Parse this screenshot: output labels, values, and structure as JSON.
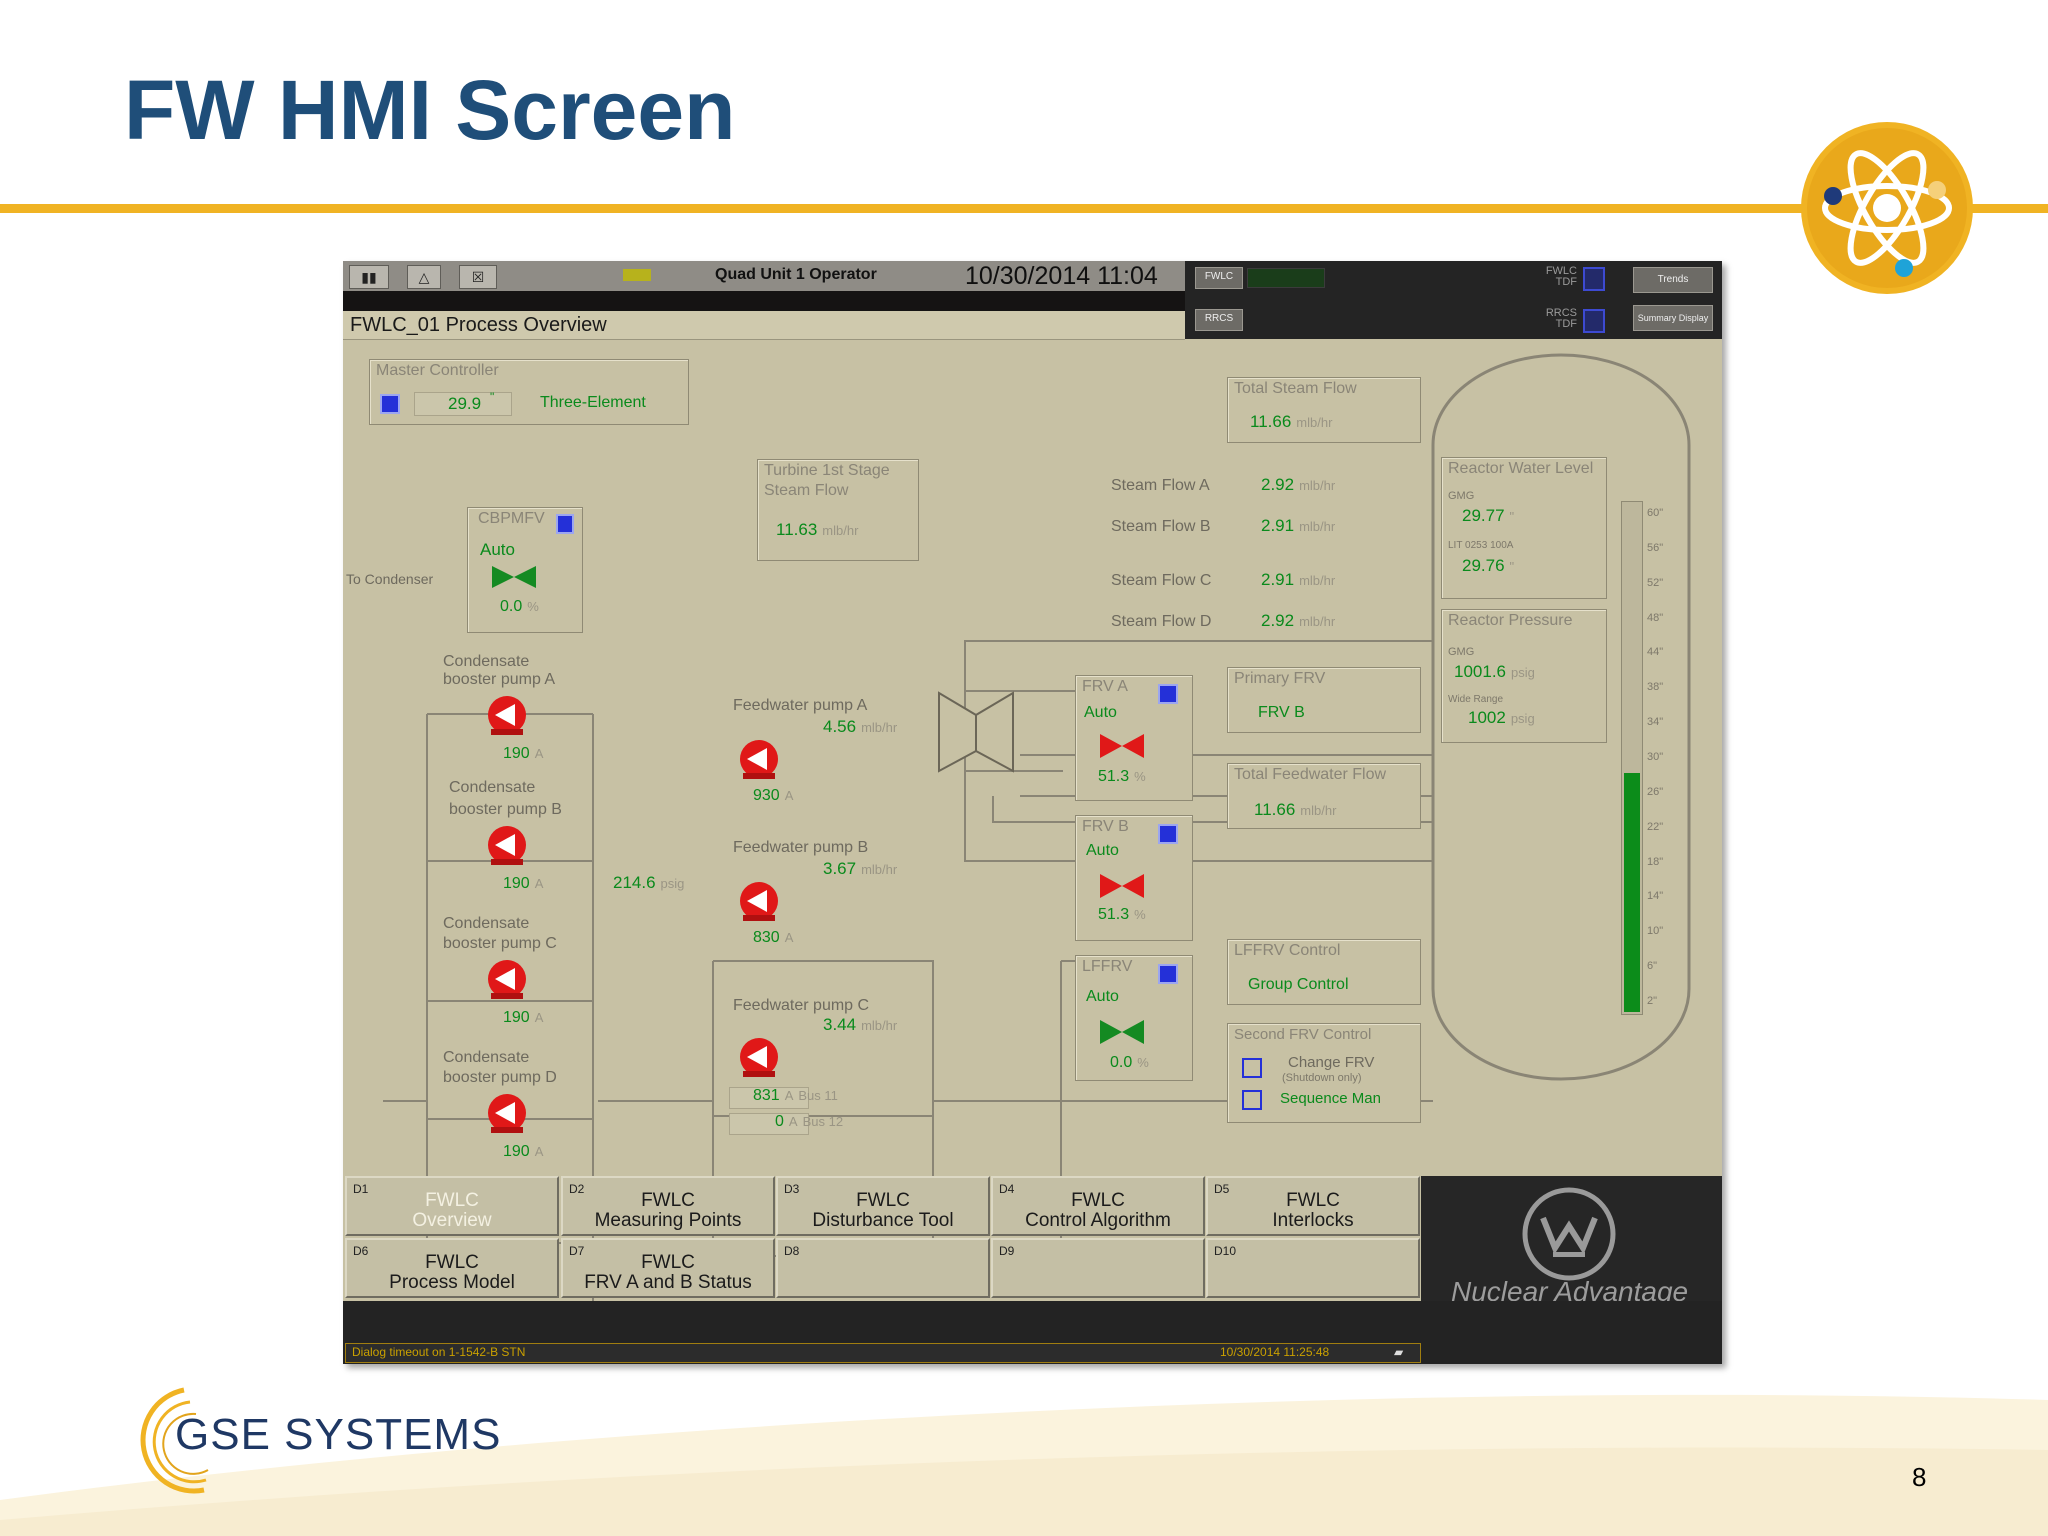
{
  "slide": {
    "title": "FW HMI Screen",
    "page_number": "8",
    "footer_logo_text": "GSE SYSTEMS"
  },
  "colors": {
    "title_blue": "#1f4e79",
    "accent_gold": "#f0b323",
    "hmi_bg": "#c7c1a4",
    "value_green": "#0a8a1c",
    "valve_red": "#e01818",
    "valve_green": "#148a22"
  },
  "hmi": {
    "toolbar": {
      "operator": "Quad Unit 1 Operator",
      "datetime": "10/30/2014  11:04"
    },
    "right_bar": {
      "fwlc_btn": "FWLC",
      "rrcs_btn": "RRCS",
      "fwlc_tdf": "FWLC\nTDF",
      "rrcs_tdf": "RRCS\nTDF",
      "trends_btn": "Trends",
      "summary_btn": "Summary Display"
    },
    "screen_title": "FWLC_01  Process Overview",
    "master_controller": {
      "title": "Master Controller",
      "value": "29.9",
      "unit": "\"",
      "mode": "Three-Element"
    },
    "total_steam_flow": {
      "title": "Total Steam Flow",
      "value": "11.66",
      "unit": "mlb/hr"
    },
    "turbine_stage": {
      "title_l1": "Turbine 1st Stage",
      "title_l2": "Steam Flow",
      "value": "11.63",
      "unit": "mlb/hr"
    },
    "steam_flows": [
      {
        "label": "Steam Flow A",
        "value": "2.92",
        "unit": "mlb/hr"
      },
      {
        "label": "Steam Flow B",
        "value": "2.91",
        "unit": "mlb/hr"
      },
      {
        "label": "Steam Flow C",
        "value": "2.91",
        "unit": "mlb/hr"
      },
      {
        "label": "Steam Flow D",
        "value": "2.92",
        "unit": "mlb/hr"
      }
    ],
    "cbpmfv": {
      "label": "CBPMFV",
      "mode": "Auto",
      "value": "0.0",
      "unit": "%",
      "to_condenser": "To Condenser"
    },
    "cond_pumps": [
      {
        "l1": "Condensate",
        "l2": "booster pump A",
        "amps": "190",
        "unit": "A"
      },
      {
        "l1": "Condensate",
        "l2": "booster pump B",
        "amps": "190",
        "unit": "A"
      },
      {
        "l1": "Condensate",
        "l2": "booster pump C",
        "amps": "190",
        "unit": "A"
      },
      {
        "l1": "Condensate",
        "l2": "booster pump D",
        "amps": "190",
        "unit": "A"
      }
    ],
    "header_pressure": {
      "value": "214.6",
      "unit": "psig"
    },
    "fw_pumps": [
      {
        "label": "Feedwater pump A",
        "flow": "4.56",
        "flow_unit": "mlb/hr",
        "amps": "930",
        "unit": "A"
      },
      {
        "label": "Feedwater pump B",
        "flow": "3.67",
        "flow_unit": "mlb/hr",
        "amps": "830",
        "unit": "A"
      },
      {
        "label": "Feedwater pump C",
        "flow": "3.44",
        "flow_unit": "mlb/hr",
        "amps": "831",
        "unit": "A"
      }
    ],
    "bus": [
      {
        "value": "831",
        "unit": "A",
        "label": "Bus 11"
      },
      {
        "value": "0",
        "unit": "A",
        "label": "Bus 12"
      }
    ],
    "frv_a": {
      "label": "FRV A",
      "mode": "Auto",
      "value": "51.3",
      "unit": "%"
    },
    "frv_b": {
      "label": "FRV B",
      "mode": "Auto",
      "value": "51.3",
      "unit": "%"
    },
    "lffrv": {
      "label": "LFFRV",
      "mode": "Auto",
      "value": "0.0",
      "unit": "%"
    },
    "primary_frv": {
      "title": "Primary FRV",
      "value": "FRV B"
    },
    "total_fw_flow": {
      "title": "Total Feedwater Flow",
      "value": "11.66",
      "unit": "mlb/hr"
    },
    "lffrv_control": {
      "title": "LFFRV Control",
      "value": "Group Control"
    },
    "second_frv": {
      "title": "Second FRV Control",
      "change_l1": "Change FRV",
      "change_l2": "(Shutdown only)",
      "sequence": "Sequence Man"
    },
    "reactor_level": {
      "title": "Reactor Water Level",
      "sub1": "GMG",
      "value1": "29.77",
      "sub2": "LIT 0253 100A",
      "value2": "29.76",
      "unit": "\""
    },
    "reactor_pressure": {
      "title": "Reactor Pressure",
      "sub1": "GMG",
      "value1": "1001.6",
      "unit": "psig",
      "sub2": "Wide Range",
      "value2": "1002"
    },
    "level_bar": {
      "fill_fraction": 0.47,
      "ticks": [
        "60\"",
        "56\"",
        "52\"",
        "48\"",
        "44\"",
        "38\"",
        "34\"",
        "30\"",
        "26\"",
        "22\"",
        "18\"",
        "14\"",
        "10\"",
        "6\"",
        "2\""
      ]
    },
    "nav": [
      {
        "code": "D1",
        "l1": "FWLC",
        "l2": "Overview",
        "dim": true
      },
      {
        "code": "D2",
        "l1": "FWLC",
        "l2": "Measuring Points"
      },
      {
        "code": "D3",
        "l1": "FWLC",
        "l2": "Disturbance Tool"
      },
      {
        "code": "D4",
        "l1": "FWLC",
        "l2": "Control Algorithm"
      },
      {
        "code": "D5",
        "l1": "FWLC",
        "l2": "Interlocks"
      },
      {
        "code": "D6",
        "l1": "FWLC",
        "l2": "Process Model"
      },
      {
        "code": "D7",
        "l1": "FWLC",
        "l2": "FRV A and B Status"
      },
      {
        "code": "D8",
        "l1": "",
        "l2": ""
      },
      {
        "code": "D9",
        "l1": "",
        "l2": ""
      },
      {
        "code": "D10",
        "l1": "",
        "l2": ""
      }
    ],
    "brand": "Nuclear Advantage",
    "status": {
      "left": "Dialog timeout on 1-1542-B STN",
      "right": "10/30/2014 11:25:48"
    }
  }
}
